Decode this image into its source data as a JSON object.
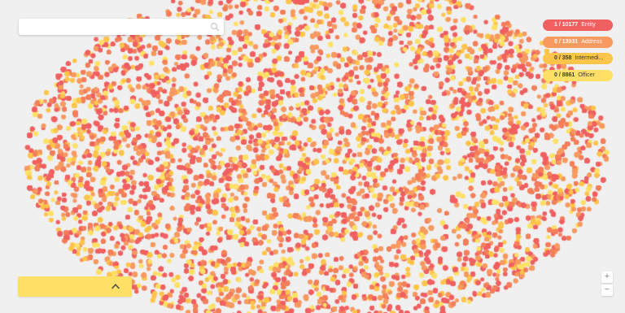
{
  "search": {
    "placeholder": "",
    "value": ""
  },
  "legend": [
    {
      "count": "1 / 10177",
      "label": "Entity",
      "color": "#f06060",
      "text_color": "#ffffff"
    },
    {
      "count": "0 / 13931",
      "label": "Address",
      "color": "#f89a60",
      "text_color": "#ffffff"
    },
    {
      "count": "0 / 358",
      "label": "Intermedi...",
      "color": "#ffc44a",
      "text_color": "#3a3a3a"
    },
    {
      "count": "0 / 8861",
      "label": "Officer",
      "color": "#ffe066",
      "text_color": "#3a3a3a"
    }
  ],
  "zoom": {
    "in_label": "+",
    "out_label": "−"
  },
  "panel": {
    "color": "#ffe066",
    "toggle_icon": "chevron-up-icon"
  },
  "icons": {
    "search": "search-icon",
    "chevron": "chevron-up-icon"
  },
  "colors": {
    "background": "#f0f0f0",
    "node_palette": [
      "#f06060",
      "#f57f5a",
      "#f89a60",
      "#ffc44a",
      "#ffe066"
    ]
  }
}
